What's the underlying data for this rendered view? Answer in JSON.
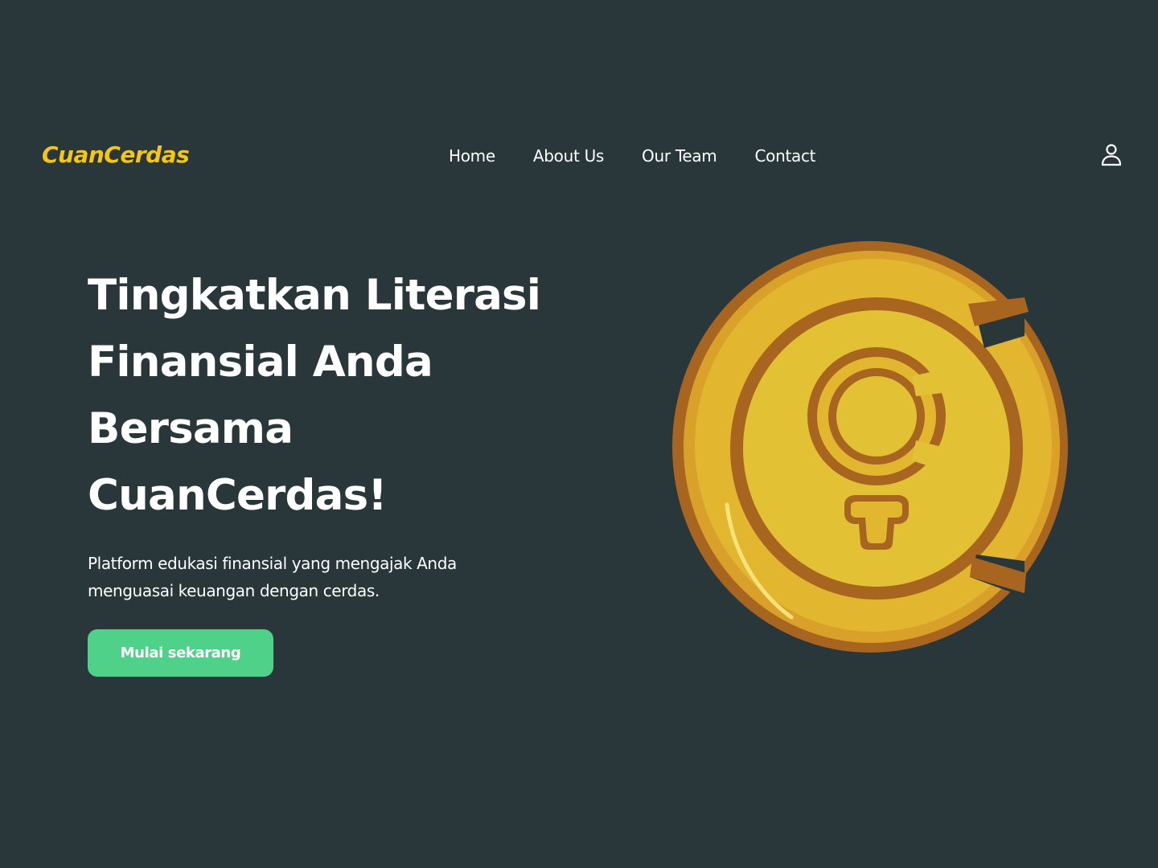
{
  "brand": {
    "name": "CuanCerdas",
    "color": "#f5c518"
  },
  "nav": {
    "items": [
      {
        "label": "Home"
      },
      {
        "label": "About Us"
      },
      {
        "label": "Our Team"
      },
      {
        "label": "Contact"
      }
    ],
    "user_icon": "user-icon"
  },
  "hero": {
    "title_lines": [
      "Tingkatkan Literasi",
      "Finansial Anda",
      "Bersama",
      "CuanCerdas!"
    ],
    "subtitle_lines": [
      "Platform edukasi finansial yang mengajak Anda",
      "menguasai keuangan dengan cerdas."
    ],
    "cta_label": "Mulai sekarang",
    "cta_color": "#4fd18a",
    "illustration": "gold-coin-icon"
  },
  "theme": {
    "background": "#29363a",
    "text": "#ffffff"
  }
}
